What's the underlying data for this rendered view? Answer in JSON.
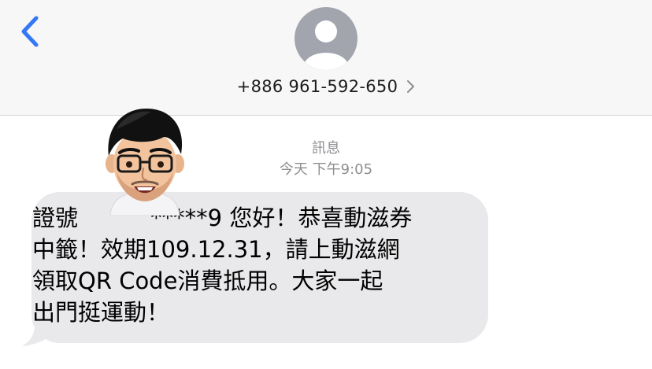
{
  "header": {
    "back_icon": "chevron-left-icon",
    "contact_icon": "person-circle-icon",
    "contact_name": "+886 961-592-650",
    "disclosure_icon": "chevron-right-icon"
  },
  "thread": {
    "service_label": "訊息",
    "timestamp": "今天 下午9:05",
    "message": {
      "lines": [
        "證號          *****9 您好！恭喜動滋券",
        "中籤！效期109.12.31，請上動滋網",
        "領取QR Code消費抵用。大家一起",
        "出門挺運動！"
      ]
    }
  },
  "colors": {
    "accent": "#3478f6",
    "header_bg": "#f7f7f7",
    "bubble_bg": "#e9e9eb",
    "secondary_text": "#8e8e93"
  }
}
